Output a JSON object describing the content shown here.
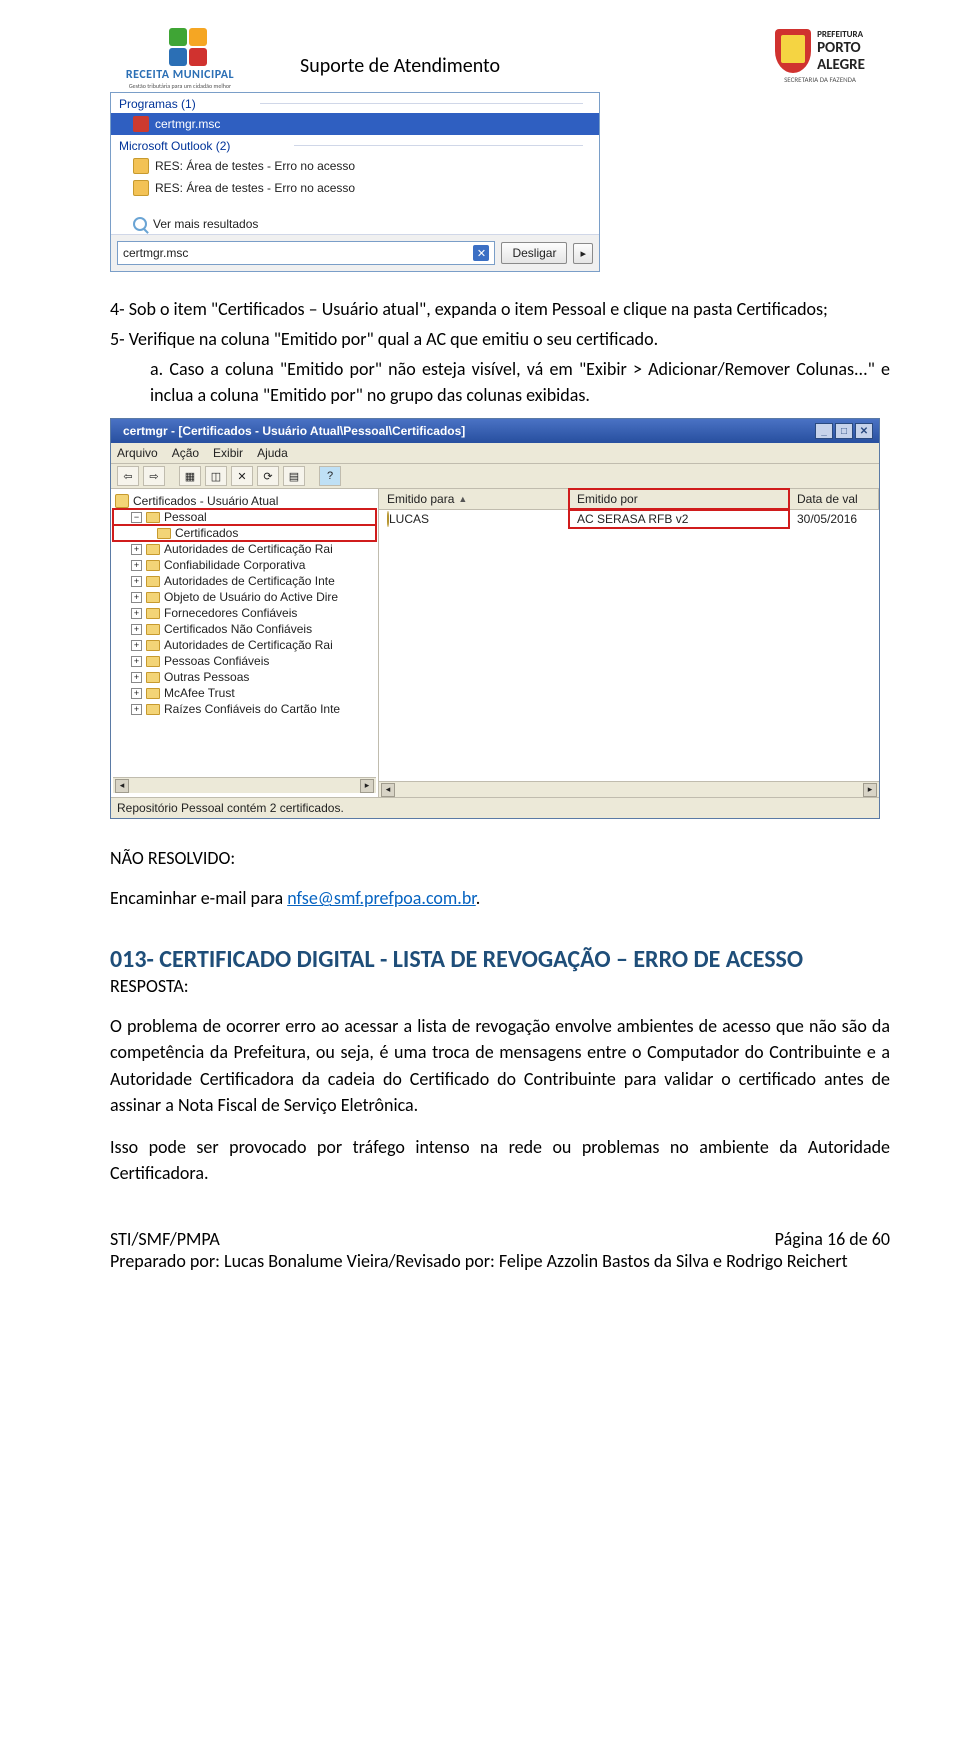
{
  "header": {
    "title": "Suporte de Atendimento",
    "left_logo": {
      "line1": "RECEITA MUNICIPAL",
      "line2": "Gestão tributária para um cidadão melhor"
    },
    "right_logo": {
      "line1": "PREFEITURA",
      "line2": "PORTO",
      "line3": "ALEGRE",
      "line4": "SECRETARIA DA FAZENDA"
    }
  },
  "search_popup": {
    "section1": "Programas (1)",
    "item1": "certmgr.msc",
    "section2": "Microsoft Outlook (2)",
    "item2": "RES: Área de testes - Erro no acesso",
    "item3": "RES: Área de testes - Erro no acesso",
    "more": "Ver mais resultados",
    "input_value": "certmgr.msc",
    "btn": "Desligar"
  },
  "steps": {
    "p1a": "4- Sob o item \"Certificados – Usuário atual\", expanda o item Pessoal e clique na pasta Certificados;",
    "p1b": "5- Verifique na coluna \"Emitido por\" qual a AC que emitiu o seu certificado.",
    "p1c": "a. Caso a coluna \"Emitido por\" não esteja visível, vá em \"Exibir > Adicionar/Remover Colunas...\" e inclua a coluna \"Emitido por\" no grupo das colunas exibidas."
  },
  "certmgr": {
    "title": "certmgr - [Certificados - Usuário Atual\\Pessoal\\Certificados]",
    "menu": {
      "m1": "Arquivo",
      "m2": "Ação",
      "m3": "Exibir",
      "m4": "Ajuda"
    },
    "tree": {
      "root": "Certificados - Usuário Atual",
      "n1": "Pessoal",
      "n1a": "Certificados",
      "n2": "Autoridades de Certificação Rai",
      "n3": "Confiabilidade Corporativa",
      "n4": "Autoridades de Certificação Inte",
      "n5": "Objeto de Usuário do Active Dire",
      "n6": "Fornecedores Confiáveis",
      "n7": "Certificados Não Confiáveis",
      "n8": "Autoridades de Certificação Rai",
      "n9": "Pessoas Confiáveis",
      "n10": "Outras Pessoas",
      "n11": "McAfee Trust",
      "n12": "Raízes Confiáveis do Cartão Inte"
    },
    "cols": {
      "c1": "Emitido para",
      "c2": "Emitido por",
      "c3": "Data de val"
    },
    "row": {
      "para": "LUCAS",
      "por": "AC SERASA RFB v2",
      "data": "30/05/2016"
    },
    "status": "Repositório Pessoal contém 2 certificados."
  },
  "nao_resolvido": {
    "title": "NÃO RESOLVIDO:",
    "text_before": "Encaminhar e-mail para ",
    "link": "nfse@smf.prefpoa.com.br",
    "text_after": "."
  },
  "section013": {
    "title": "013- CERTIFICADO DIGITAL - LISTA DE REVOGAÇÃO – ERRO DE ACESSO",
    "resposta": "RESPOSTA:",
    "p1": "O problema de ocorrer erro ao acessar a lista de revogação envolve ambientes de acesso que não são da competência da Prefeitura, ou seja, é uma troca de mensagens entre o Computador do Contribuinte e a Autoridade Certificadora da cadeia do Certificado do Contribuinte para validar o certificado antes de assinar a Nota Fiscal de Serviço Eletrônica.",
    "p2": "Isso pode ser provocado por tráfego intenso na rede ou problemas no ambiente da Autoridade Certificadora."
  },
  "footer": {
    "left": "STI/SMF/PMPA",
    "right": "Página 16 de 60",
    "by": "Preparado por: Lucas Bonalume Vieira/Revisado por: Felipe Azzolin Bastos da Silva e Rodrigo Reichert"
  }
}
